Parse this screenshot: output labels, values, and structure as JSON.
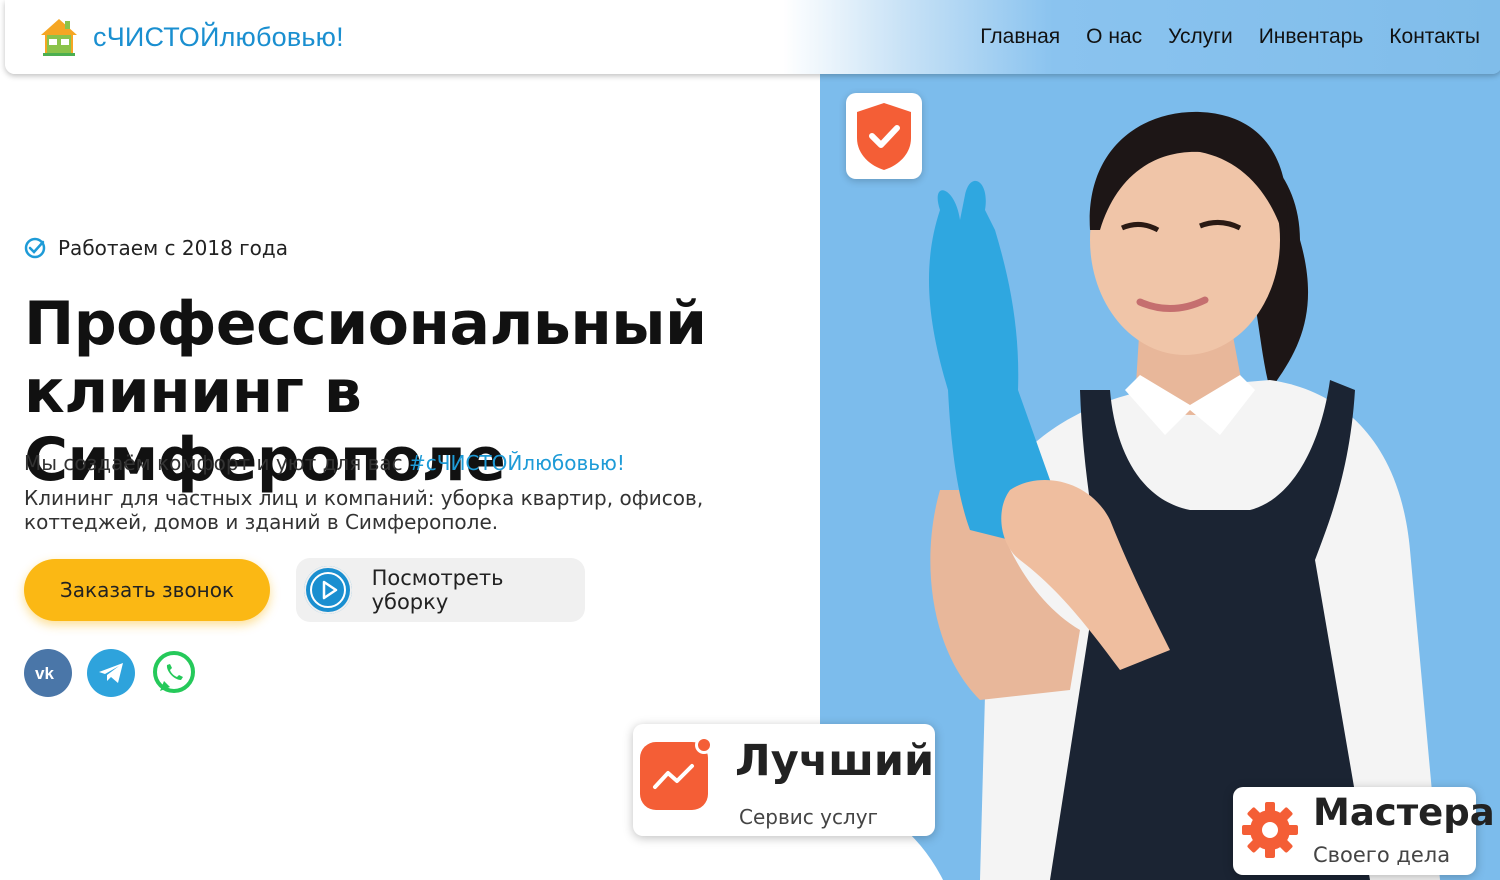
{
  "header": {
    "brand_name": "сЧИСТОЙлюбовью!",
    "nav": [
      "Главная",
      "О нас",
      "Услуги",
      "Инвентарь",
      "Контакты"
    ]
  },
  "hero": {
    "since": "Работаем с 2018 года",
    "title_line1": "Профессиональный",
    "title_line2": "клининг в Симферополе",
    "subtitle_prefix": "Мы создаём комфорт и уют для вас ",
    "subtitle_hashtag": "#сЧИСТОЙлюбовью!",
    "description": "Клининг для частных лиц и компаний: уборка квартир, офисов, коттеджей, домов и зданий в Симферополе.",
    "call_button": "Заказать звонок",
    "watch_button": "Посмотреть уборку"
  },
  "socials": [
    "vk-icon",
    "telegram-icon",
    "whatsapp-icon"
  ],
  "cards": {
    "best_title": "Лучший",
    "best_sub": "Сервис услуг",
    "master_title": "Мастера",
    "master_sub": "Своего дела"
  },
  "colors": {
    "accent_blue": "#1a8fd0",
    "panel_blue": "#7cbcec",
    "button_yellow": "#fbb814",
    "card_orange": "#f45e36"
  }
}
